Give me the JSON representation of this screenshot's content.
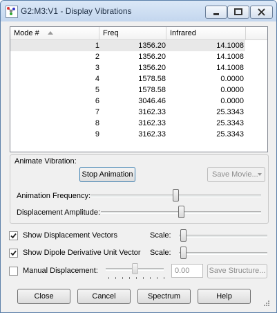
{
  "window": {
    "title": "G2:M3:V1 - Display Vibrations"
  },
  "table": {
    "columns": [
      "Mode #",
      "Freq",
      "Infrared"
    ],
    "sorted_column": "Mode #",
    "selected_row": 0,
    "rows": [
      {
        "mode": "1",
        "freq": "1356.20",
        "ir": "14.1008"
      },
      {
        "mode": "2",
        "freq": "1356.20",
        "ir": "14.1008"
      },
      {
        "mode": "3",
        "freq": "1356.20",
        "ir": "14.1008"
      },
      {
        "mode": "4",
        "freq": "1578.58",
        "ir": "0.0000"
      },
      {
        "mode": "5",
        "freq": "1578.58",
        "ir": "0.0000"
      },
      {
        "mode": "6",
        "freq": "3046.46",
        "ir": "0.0000"
      },
      {
        "mode": "7",
        "freq": "3162.33",
        "ir": "25.3343"
      },
      {
        "mode": "8",
        "freq": "3162.33",
        "ir": "25.3343"
      },
      {
        "mode": "9",
        "freq": "3162.33",
        "ir": "25.3343"
      }
    ]
  },
  "animate": {
    "group_label": "Animate Vibration:",
    "stop_button": "Stop Animation",
    "save_movie": "Save Movie...",
    "frequency_label": "Animation Frequency:",
    "frequency_level": 0.5,
    "amplitude_label": "Displacement Amplitude:",
    "amplitude_level": 0.5
  },
  "options": {
    "show_vectors_label": "Show Displacement Vectors",
    "show_vectors_checked": true,
    "show_dipole_label": "Show Dipole Derivative Unit Vector",
    "show_dipole_checked": true,
    "scale_label": "Scale:",
    "vectors_scale_level": 0.02,
    "dipole_scale_level": 0.02,
    "manual_label": "Manual Displacement:",
    "manual_checked": false,
    "manual_level": 0.5,
    "manual_value": "0.00",
    "save_structure": "Save Structure..."
  },
  "buttons": {
    "close": "Close",
    "cancel": "Cancel",
    "spectrum": "Spectrum",
    "help": "Help"
  },
  "icons": {
    "app": "gaussview-molecule-icon",
    "minimize": "minimize-icon",
    "maximize": "maximize-icon",
    "close": "close-icon",
    "sort": "sort-ascending-icon",
    "check": "check-icon",
    "dropdown": "chevron-down-icon",
    "grip": "resize-grip-icon"
  },
  "colors": {
    "title_bar": "#c3d6ee",
    "close_button": "#c75050",
    "default_button_border": "#3c7fb1"
  }
}
